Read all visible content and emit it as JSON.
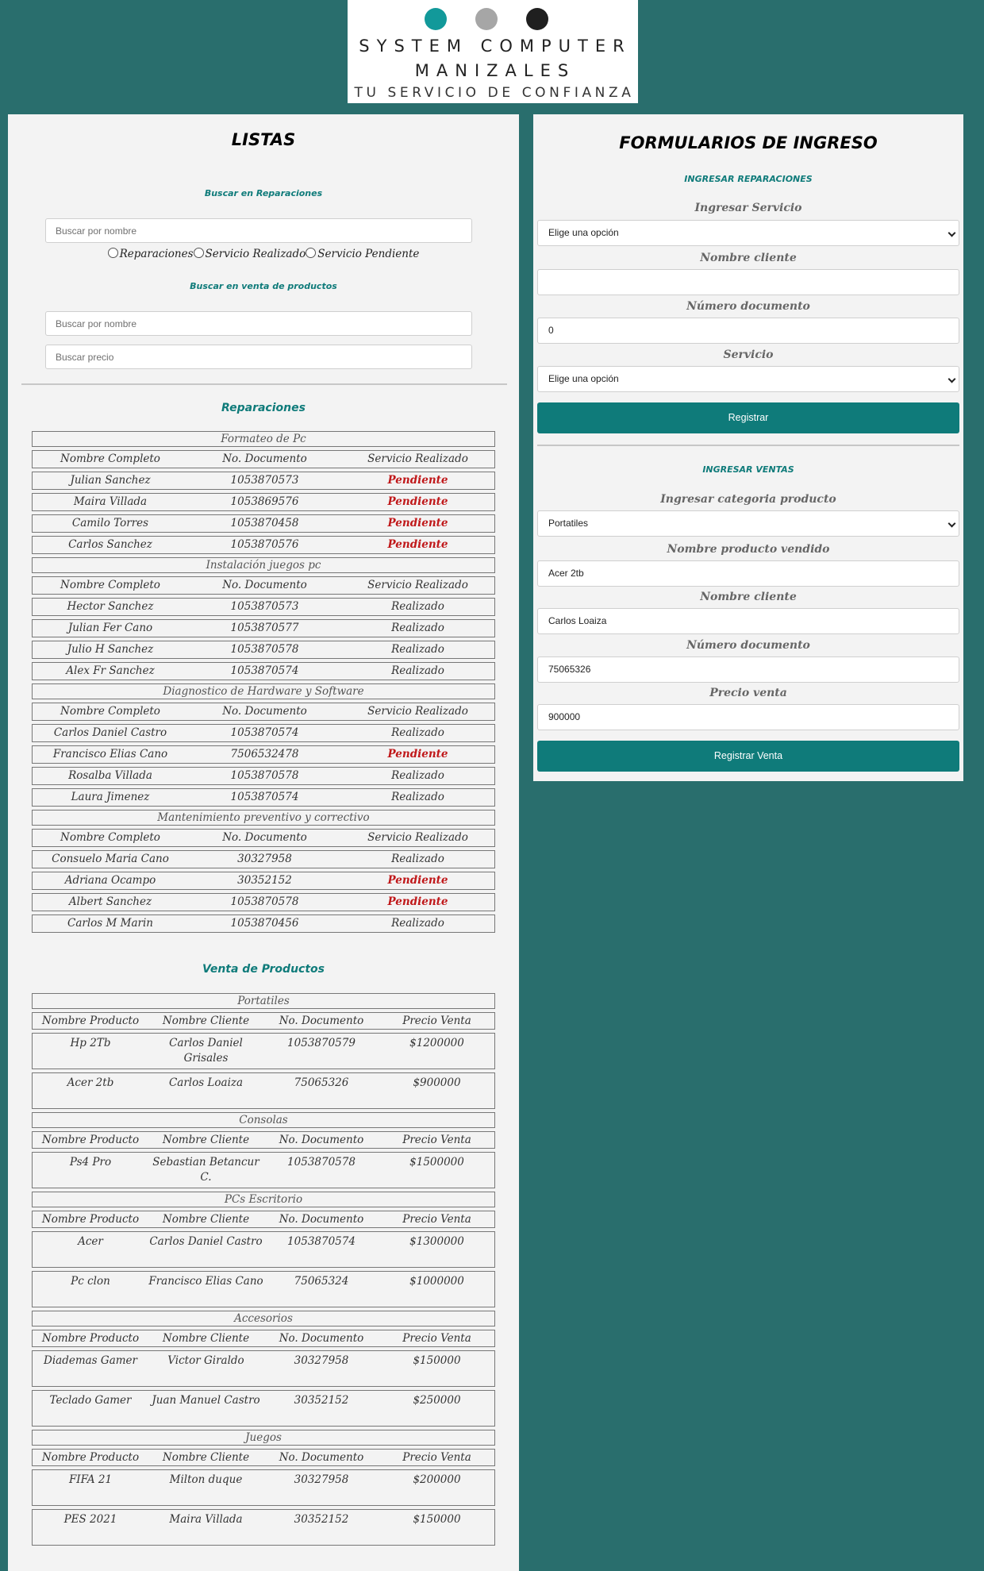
{
  "brand": {
    "line1": "SYSTEM COMPUTER",
    "line2": "MANIZALES",
    "line3": "TU SERVICIO DE CONFIANZA",
    "dot_colors": [
      "#12999a",
      "#a6a6a6",
      "#1f1f1f"
    ]
  },
  "lists": {
    "title": "LISTAS",
    "search_repairs_label": "Buscar en Reparaciones",
    "search_repairs_placeholder": "Buscar por nombre",
    "radio_options": [
      "Reparaciones",
      "Servicio Realizado",
      "Servicio Pendiente"
    ],
    "search_sales_label": "Buscar en venta de productos",
    "search_sales_name_placeholder": "Buscar por nombre",
    "search_sales_price_placeholder": "Buscar precio",
    "repairs_heading": "Reparaciones",
    "repair_headers": [
      "Nombre Completo",
      "No. Documento",
      "Servicio Realizado"
    ],
    "repair_groups": [
      {
        "category": "Formateo de Pc",
        "rows": [
          {
            "name": "Julian Sanchez",
            "doc": "1053870573",
            "status": "Pendiente"
          },
          {
            "name": "Maira Villada",
            "doc": "1053869576",
            "status": "Pendiente"
          },
          {
            "name": "Camilo Torres",
            "doc": "1053870458",
            "status": "Pendiente"
          },
          {
            "name": "Carlos Sanchez",
            "doc": "1053870576",
            "status": "Pendiente"
          }
        ]
      },
      {
        "category": "Instalación juegos pc",
        "rows": [
          {
            "name": "Hector Sanchez",
            "doc": "1053870573",
            "status": "Realizado"
          },
          {
            "name": "Julian Fer Cano",
            "doc": "1053870577",
            "status": "Realizado"
          },
          {
            "name": "Julio H Sanchez",
            "doc": "1053870578",
            "status": "Realizado"
          },
          {
            "name": "Alex Fr Sanchez",
            "doc": "1053870574",
            "status": "Realizado"
          }
        ]
      },
      {
        "category": "Diagnostico de Hardware y Software",
        "rows": [
          {
            "name": "Carlos Daniel Castro",
            "doc": "1053870574",
            "status": "Realizado"
          },
          {
            "name": "Francisco Elias Cano",
            "doc": "7506532478",
            "status": "Pendiente"
          },
          {
            "name": "Rosalba Villada",
            "doc": "1053870578",
            "status": "Realizado"
          },
          {
            "name": "Laura Jimenez",
            "doc": "1053870574",
            "status": "Realizado"
          }
        ]
      },
      {
        "category": "Mantenimiento preventivo y correctivo",
        "rows": [
          {
            "name": "Consuelo Maria Cano",
            "doc": "30327958",
            "status": "Realizado"
          },
          {
            "name": "Adriana Ocampo",
            "doc": "30352152",
            "status": "Pendiente"
          },
          {
            "name": "Albert Sanchez",
            "doc": "1053870578",
            "status": "Pendiente"
          },
          {
            "name": "Carlos M Marin",
            "doc": "1053870456",
            "status": "Realizado"
          }
        ]
      }
    ],
    "sales_heading": "Venta de Productos",
    "sales_headers": [
      "Nombre Producto",
      "Nombre Cliente",
      "No. Documento",
      "Precio Venta"
    ],
    "sales_groups": [
      {
        "category": "Portatiles",
        "rows": [
          {
            "product": "Hp 2Tb",
            "client": "Carlos Daniel Grisales",
            "doc": "1053870579",
            "price": "$1200000"
          },
          {
            "product": "Acer 2tb",
            "client": "Carlos Loaiza",
            "doc": "75065326",
            "price": "$900000"
          }
        ]
      },
      {
        "category": "Consolas",
        "rows": [
          {
            "product": "Ps4 Pro",
            "client": "Sebastian Betancur C.",
            "doc": "1053870578",
            "price": "$1500000"
          }
        ]
      },
      {
        "category": "PCs Escritorio",
        "rows": [
          {
            "product": "Acer",
            "client": "Carlos Daniel Castro",
            "doc": "1053870574",
            "price": "$1300000"
          },
          {
            "product": "Pc clon",
            "client": "Francisco Elias Cano",
            "doc": "75065324",
            "price": "$1000000"
          }
        ]
      },
      {
        "category": "Accesorios",
        "rows": [
          {
            "product": "Diademas Gamer",
            "client": "Victor Giraldo",
            "doc": "30327958",
            "price": "$150000"
          },
          {
            "product": "Teclado Gamer",
            "client": "Juan Manuel Castro",
            "doc": "30352152",
            "price": "$250000"
          }
        ]
      },
      {
        "category": "Juegos",
        "rows": [
          {
            "product": "FIFA 21",
            "client": "Milton duque",
            "doc": "30327958",
            "price": "$200000"
          },
          {
            "product": "PES 2021",
            "client": "Maira Villada",
            "doc": "30352152",
            "price": "$150000"
          }
        ]
      }
    ]
  },
  "forms": {
    "title": "FORMULARIOS DE INGRESO",
    "repairs": {
      "heading": "INGRESAR REPARACIONES",
      "service_label": "Ingresar Servicio",
      "service_value": "Elige una opción",
      "client_label": "Nombre cliente",
      "client_value": "",
      "doc_label": "Número documento",
      "doc_value": "0",
      "servicio_label": "Servicio",
      "servicio_value": "Elige una opción",
      "button": "Registrar"
    },
    "sales": {
      "heading": "INGRESAR VENTAS",
      "category_label": "Ingresar categoria producto",
      "category_value": "Portatiles",
      "product_label": "Nombre producto vendido",
      "product_value": "Acer 2tb",
      "client_label": "Nombre cliente",
      "client_value": "Carlos Loaiza",
      "doc_label": "Número documento",
      "doc_value": "75065326",
      "price_label": "Precio venta",
      "price_value": "900000",
      "button": "Registrar Venta"
    }
  },
  "colors": {
    "background": "#296e6d",
    "accent": "#0f7b7a",
    "pending": "#c0181a"
  }
}
